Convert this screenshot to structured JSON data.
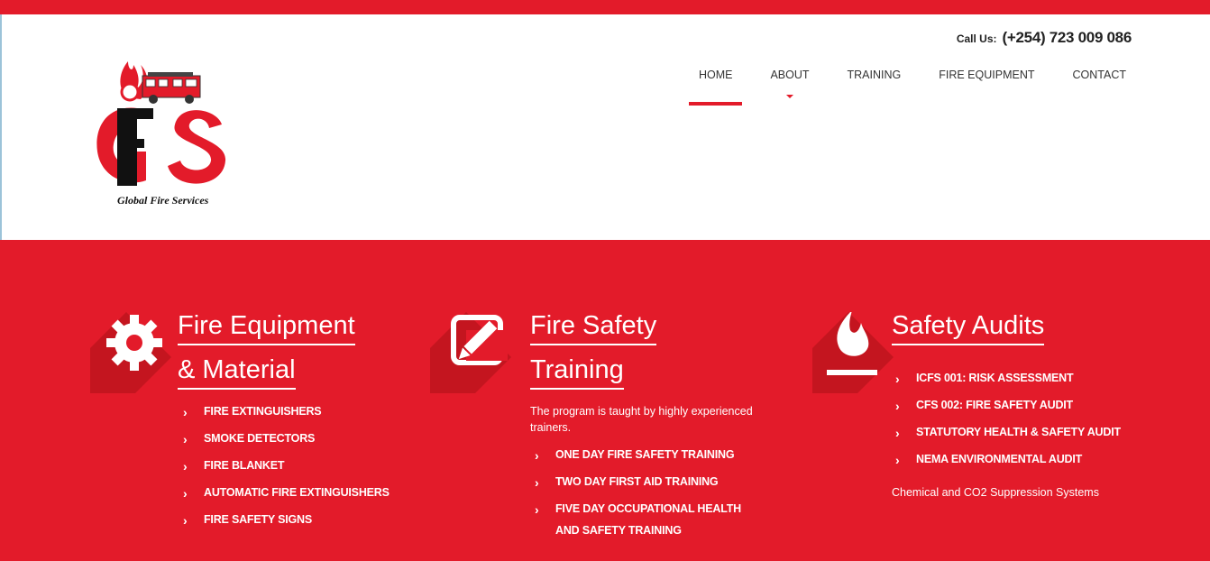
{
  "header": {
    "logo_text": "Global Fire Services",
    "logo_letters": "GFS",
    "call_label": "Call Us:",
    "call_number": "(+254) 723 009 086"
  },
  "nav": {
    "items": [
      {
        "label": "HOME",
        "active": true
      },
      {
        "label": "ABOUT",
        "has_dropdown": true
      },
      {
        "label": "TRAINING"
      },
      {
        "label": "FIRE EQUIPMENT"
      },
      {
        "label": "CONTACT"
      }
    ]
  },
  "columns": [
    {
      "icon": "gear-icon",
      "title_line1": "Fire Equipment",
      "title_line2": "& Material",
      "items": [
        "FIRE EXTINGUISHERS",
        "SMOKE DETECTORS",
        "FIRE BLANKET",
        "AUTOMATIC FIRE EXTINGUISHERS",
        "FIRE SAFETY SIGNS"
      ]
    },
    {
      "icon": "edit-icon",
      "title_line1": "Fire Safety",
      "title_line2": "Training",
      "description": "The program is taught by highly experienced trainers.",
      "items": [
        "ONE DAY FIRE SAFETY TRAINING",
        "TWO DAY FIRST AID TRAINING",
        "FIVE DAY OCCUPATIONAL HEALTH AND SAFETY TRAINING"
      ]
    },
    {
      "icon": "flame-icon",
      "title_line1": "Safety Audits",
      "items": [
        "ICFS 001: RISK ASSESSMENT",
        "CFS 002: FIRE SAFETY AUDIT",
        "STATUTORY HEALTH & SAFETY AUDIT",
        "NEMA ENVIRONMENTAL AUDIT"
      ],
      "footer": "Chemical and CO2 Suppression Systems"
    }
  ],
  "colors": {
    "brand_red": "#e31b2a",
    "shadow_red": "#c4151f"
  }
}
